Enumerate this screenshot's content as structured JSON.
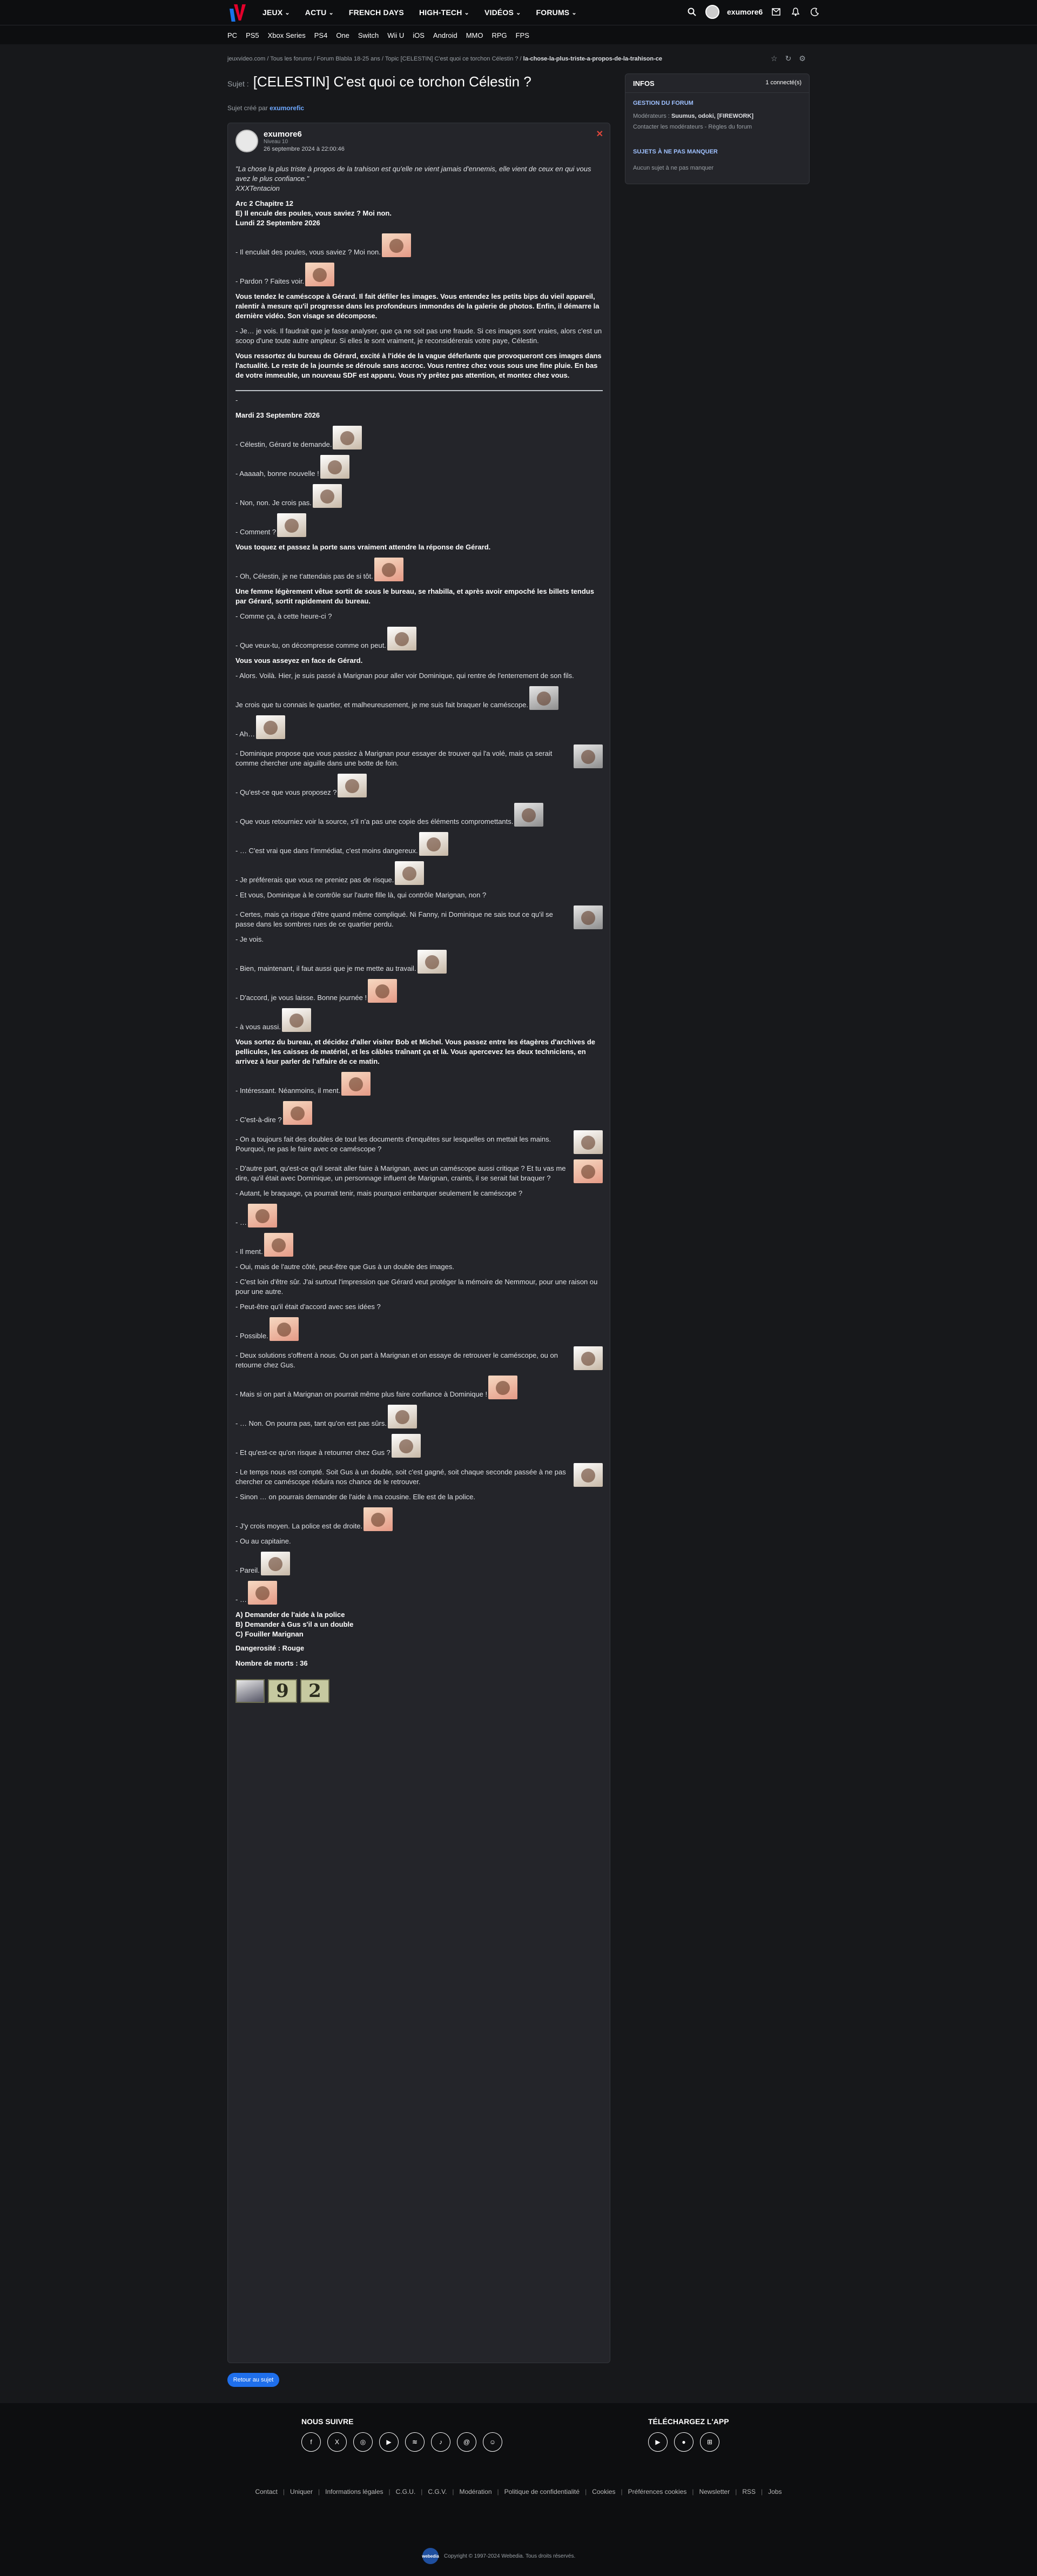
{
  "header": {
    "nav": [
      "JEUX",
      "ACTU",
      "FRENCH DAYS",
      "HIGH-TECH",
      "VIDÉOS",
      "FORUMS"
    ],
    "username": "exumore6",
    "platforms": [
      "PC",
      "PS5",
      "Xbox Series",
      "PS4",
      "One",
      "Switch",
      "Wii U",
      "iOS",
      "Android",
      "MMO",
      "RPG",
      "FPS"
    ]
  },
  "breadcrumb": "jeuxvideo.com / Tous les forums / Forum Blabla 18-25 ans / Topic [CELESTIN] C'est quoi ce torchon Célestin ? / ",
  "breadcrumb_current": "la-chose-la-plus-triste-a-propos-de-la-trahison-ce",
  "subject": {
    "label": "Sujet :",
    "title": "[CELESTIN] C'est quoi ce torchon Célestin ?"
  },
  "created_by": {
    "prefix": "Sujet créé par",
    "author": "exumorefic"
  },
  "post": {
    "author": "exumore6",
    "level": "Niveau 10",
    "date": "26 septembre 2024 à 22:00:46",
    "quote": "\"La chose la plus triste à propos de la trahison est qu'elle ne vient jamais d'ennemis, elle vient de ceux en qui vous avez le plus confiance.\"",
    "quote_sig": "XXXTentacion",
    "arc": "Arc 2 Chapitre 12",
    "title_line": "E) Il encule des poules, vous saviez ? Moi non.",
    "date_line": "Lundi 22 Septembre 2026",
    "lines": [
      {
        "t": "- Il enculait des poules, vous saviez ? Moi non.",
        "b": false,
        "s": "c"
      },
      {
        "t": "- Pardon ? Faites voir.",
        "b": false,
        "s": "c"
      },
      {
        "t": "Vous tendez le caméscope à Gérard. Il fait défiler les images. Vous entendez les petits bips du vieil appareil, ralentir à mesure qu'il progresse dans les profondeurs immondes de la galerie de photos. Enfin, il démarre la dernière vidéo. Son visage se décompose.",
        "b": true,
        "s": ""
      },
      {
        "t": "- Je… je vois. Il faudrait que je fasse analyser, que ça ne soit pas une fraude. Si ces images sont vraies, alors c'est un scoop d'une toute autre ampleur. Si elles le sont vraiment, je reconsidérerais votre paye, Célestin.",
        "b": false,
        "s": ""
      },
      {
        "t": "Vous ressortez du bureau de Gérard, excité à l'idée de la vague déferlante que provoqueront ces images dans l'actualité. Le reste de la journée se déroule sans accroc. Vous rentrez chez vous sous une fine pluie. En bas de votre immeuble, un nouveau SDF est apparu. Vous n'y prêtez pas attention, et montez chez vous.",
        "b": true,
        "s": ""
      }
    ],
    "date_line2": "Mardi 23 Septembre 2026",
    "lines2": [
      {
        "t": "- Célestin, Gérard te demande.",
        "b": false,
        "s": "w"
      },
      {
        "t": "- Aaaaah, bonne nouvelle !",
        "b": false,
        "s": "w"
      },
      {
        "t": "- Non, non. Je crois pas.",
        "b": false,
        "s": "w"
      },
      {
        "t": "- Comment ?",
        "b": false,
        "s": "w"
      },
      {
        "t": "Vous toquez et passez la porte sans vraiment attendre la réponse de Gérard.",
        "b": true,
        "s": ""
      },
      {
        "t": "- Oh, Célestin, je ne t'attendais pas de si tôt.",
        "b": false,
        "s": "c"
      },
      {
        "t": "Une femme légèrement vêtue sortit de sous le bureau, se rhabilla, et après avoir empoché les billets tendus par Gérard, sortit rapidement du bureau.",
        "b": true,
        "s": ""
      },
      {
        "t": "- Comme ça, à cette heure-ci ?",
        "b": false,
        "s": ""
      },
      {
        "t": "- Que veux-tu, on décompresse comme on peut.",
        "b": false,
        "s": "w"
      },
      {
        "t": "Vous vous asseyez en face de Gérard.",
        "b": true,
        "s": ""
      },
      {
        "t": "- Alors. Voilà. Hier, je suis passé à Marignan pour aller voir Dominique, qui rentre de l'enterrement de son fils.",
        "b": false,
        "s": ""
      },
      {
        "t": "Je crois que tu connais le quartier, et malheureusement, je me suis fait braquer le caméscope.",
        "b": false,
        "s": "g"
      },
      {
        "t": "- Ah…",
        "b": false,
        "s": "w"
      },
      {
        "t": "- Dominique propose que vous passiez à Marignan pour essayer de trouver qui l'a volé, mais ça serait comme chercher une aiguille dans une botte de foin.",
        "b": false,
        "s": "g"
      },
      {
        "t": "- Qu'est-ce que vous proposez ?",
        "b": false,
        "s": "w"
      },
      {
        "t": "- Que vous retourniez voir la source, s'il n'a pas une copie des éléments compromettants.",
        "b": false,
        "s": "g"
      },
      {
        "t": "- … C'est vrai que dans l'immédiat, c'est moins dangereux.",
        "b": false,
        "s": "w"
      },
      {
        "t": "- Je préférerais que vous ne preniez pas de risque.",
        "b": false,
        "s": "w"
      },
      {
        "t": "- Et vous, Dominique à le contrôle sur l'autre fille là, qui contrôle Marignan, non ?",
        "b": false,
        "s": ""
      },
      {
        "t": "- Certes, mais ça risque d'être quand même compliqué. Ni Fanny, ni Dominique ne sais tout ce qu'il se passe dans les sombres rues de ce quartier perdu.",
        "b": false,
        "s": "g"
      },
      {
        "t": "- Je vois.",
        "b": false,
        "s": ""
      },
      {
        "t": "- Bien, maintenant, il faut aussi que je me mette au travail.",
        "b": false,
        "s": "w"
      },
      {
        "t": "- D'accord, je vous laisse. Bonne journée !",
        "b": false,
        "s": "c"
      },
      {
        "t": "- à vous aussi.",
        "b": false,
        "s": "w"
      },
      {
        "t": "Vous sortez du bureau, et décidez d'aller visiter Bob et Michel. Vous passez entre les étagères d'archives de pellicules, les caisses de matériel, et les câbles traînant ça et là. Vous apercevez les deux techniciens, en arrivez à leur parler de l'affaire de ce matin.",
        "b": true,
        "s": ""
      },
      {
        "t": "- Intéressant. Néanmoins, il ment.",
        "b": false,
        "s": "c"
      },
      {
        "t": "- C'est-à-dire ?",
        "b": false,
        "s": "c"
      },
      {
        "t": "- On a toujours fait des doubles de tout les documents d'enquêtes sur lesquelles on mettait les mains. Pourquoi, ne pas le faire avec ce caméscope ?",
        "b": false,
        "s": "w"
      },
      {
        "t": "- D'autre part, qu'est-ce qu'il serait aller faire à Marignan, avec un caméscope aussi critique ? Et tu vas me dire, qu'il était avec Dominique, un personnage influent de Marignan, craints, il se serait fait braquer ?",
        "b": false,
        "s": "c"
      },
      {
        "t": "- Autant, le braquage, ça pourrait tenir, mais pourquoi embarquer seulement le caméscope ?",
        "b": false,
        "s": ""
      },
      {
        "t": "- …",
        "b": false,
        "s": "c"
      },
      {
        "t": "- Il ment.",
        "b": false,
        "s": "c"
      },
      {
        "t": "- Oui, mais de l'autre côté, peut-être que Gus à un double des images.",
        "b": false,
        "s": ""
      },
      {
        "t": "- C'est loin d'être sûr. J'ai surtout l'impression que Gérard veut protéger la mémoire de Nemmour, pour une raison ou pour une autre.",
        "b": false,
        "s": ""
      },
      {
        "t": "- Peut-être qu'il était d'accord avec ses idées ?",
        "b": false,
        "s": ""
      },
      {
        "t": "- Possible.",
        "b": false,
        "s": "c"
      },
      {
        "t": "- Deux solutions s'offrent à nous. Ou on part à Marignan et on essaye de retrouver le caméscope, ou on retourne chez Gus.",
        "b": false,
        "s": "w"
      },
      {
        "t": "- Mais si on part à Marignan on pourrait même plus faire confiance à Dominique !",
        "b": false,
        "s": "c"
      },
      {
        "t": "- … Non. On pourra pas, tant qu'on est pas sûrs.",
        "b": false,
        "s": "w"
      },
      {
        "t": "- Et qu'est-ce qu'on risque à retourner chez Gus ?",
        "b": false,
        "s": "w"
      },
      {
        "t": "- Le temps nous est compté. Soit Gus à un double, soit c'est gagné, soit chaque seconde passée à ne pas chercher ce caméscope réduira nos chance de le retrouver.",
        "b": false,
        "s": "w"
      },
      {
        "t": "- Sinon … on pourrais demander de l'aide à ma cousine. Elle est de la police.",
        "b": false,
        "s": ""
      },
      {
        "t": "- J'y crois moyen. La police est de droite.",
        "b": false,
        "s": "c"
      },
      {
        "t": "- Ou au capitaine.",
        "b": false,
        "s": ""
      },
      {
        "t": "- Pareil.",
        "b": false,
        "s": "w"
      },
      {
        "t": "- …",
        "b": false,
        "s": "c"
      }
    ],
    "choices": [
      "A) Demander de l'aide à la police",
      "B) Demander à Gus s'il a un double",
      "C) Fouiller Marignan"
    ],
    "danger": "Dangerosité : Rouge",
    "deaths": "Nombre de morts : 36",
    "score_digits": [
      "9",
      "2"
    ]
  },
  "sidebar": {
    "title": "INFOS",
    "connected": "1 connecté(s)",
    "sec1": "GESTION DU FORUM",
    "mods_prefix": "Modérateurs :",
    "mods": "Suumus, odoki, [FIREWORK]",
    "contact": "Contacter les modérateurs - Règles du forum",
    "sec2": "SUJETS À NE PAS MANQUER",
    "none": "Aucun sujet à ne pas manquer"
  },
  "back_button": "Retour au sujet",
  "footer": {
    "follow": "NOUS SUIVRE",
    "download": "TÉLÉCHARGEZ L'APP",
    "socials": [
      "facebook-icon",
      "x-icon",
      "instagram-icon",
      "youtube-icon",
      "rss-icon",
      "tiktok-icon",
      "threads-icon",
      "snapchat-icon"
    ],
    "links": [
      "Contact",
      "Uniquer",
      "Informations légales",
      "C.G.U.",
      "C.G.V.",
      "Modération",
      "Politique de confidentialité",
      "Cookies",
      "Préférences cookies",
      "Newsletter",
      "RSS",
      "Jobs"
    ],
    "copyright": "Copyright © 1997-2024 Webedia. Tous droits réservés.",
    "brand": "webedia"
  }
}
